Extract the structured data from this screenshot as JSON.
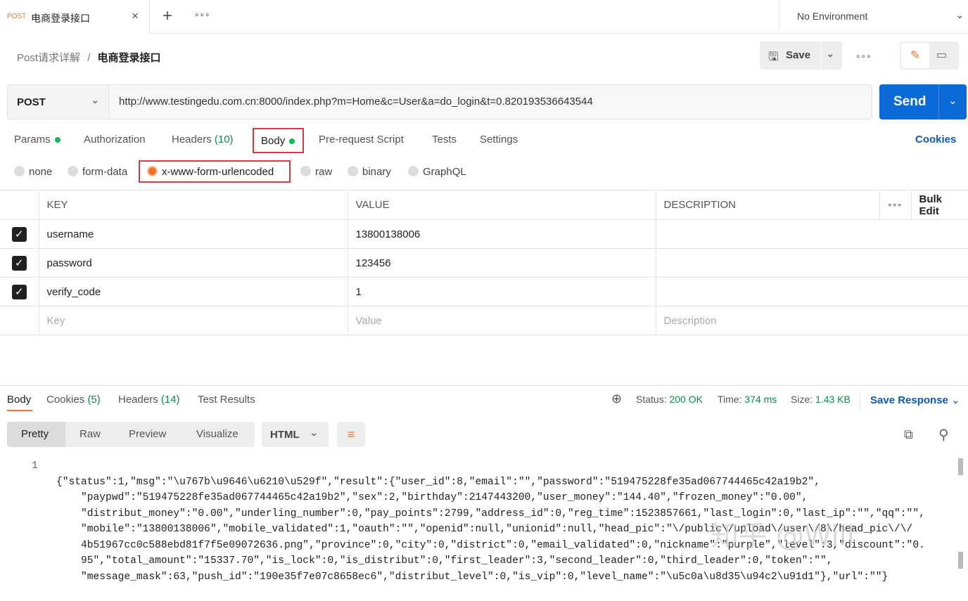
{
  "tabbar": {
    "tab_method": "POST",
    "tab_title": "电商登录接口",
    "close": "×",
    "new_tab": "+",
    "more": "∘∘∘",
    "environment": "No Environment"
  },
  "breadcrumb": {
    "parent": "Post请求详解",
    "sep": "/",
    "current": "电商登录接口"
  },
  "actions": {
    "save": "Save",
    "more": "∘∘∘"
  },
  "request": {
    "method": "POST",
    "url": "http://www.testingedu.com.cn:8000/index.php?m=Home&c=User&a=do_login&t=0.820193536643544",
    "send": "Send"
  },
  "req_tabs": {
    "params": "Params",
    "authorization": "Authorization",
    "headers": "Headers",
    "headers_count": "(10)",
    "body": "Body",
    "prerequest": "Pre-request Script",
    "tests": "Tests",
    "settings": "Settings",
    "cookies": "Cookies"
  },
  "body_types": [
    "none",
    "form-data",
    "x-www-form-urlencoded",
    "raw",
    "binary",
    "GraphQL"
  ],
  "table": {
    "headers": [
      "KEY",
      "VALUE",
      "DESCRIPTION"
    ],
    "more": "∘∘∘",
    "bulk_edit": "Bulk Edit",
    "rows": [
      {
        "key": "username",
        "value": "13800138006"
      },
      {
        "key": "password",
        "value": "123456"
      },
      {
        "key": "verify_code",
        "value": "1"
      }
    ],
    "placeholder": {
      "key": "Key",
      "value": "Value",
      "description": "Description"
    }
  },
  "response": {
    "tabs": {
      "body": "Body",
      "cookies": "Cookies",
      "cookies_count": "(5)",
      "headers": "Headers",
      "headers_count": "(14)",
      "test_results": "Test Results"
    },
    "status_label": "Status:",
    "status": "200 OK",
    "time_label": "Time:",
    "time": "374 ms",
    "size_label": "Size:",
    "size": "1.43 KB",
    "save_response": "Save Response",
    "views": [
      "Pretty",
      "Raw",
      "Preview",
      "Visualize"
    ],
    "format": "HTML",
    "line_number": "1",
    "lines": [
      "{\"status\":1,\"msg\":\"\\u767b\\u9646\\u6210\\u529f\",\"result\":{\"user_id\":8,\"email\":\"\",\"password\":\"519475228fe35ad067744465c42a19b2\",",
      "    \"paypwd\":\"519475228fe35ad067744465c42a19b2\",\"sex\":2,\"birthday\":2147443200,\"user_money\":\"144.40\",\"frozen_money\":\"0.00\",",
      "    \"distribut_money\":\"0.00\",\"underling_number\":0,\"pay_points\":2799,\"address_id\":0,\"reg_time\":1523857661,\"last_login\":0,\"last_ip\":\"\",\"qq\":\"\",",
      "    \"mobile\":\"13800138006\",\"mobile_validated\":1,\"oauth\":\"\",\"openid\":null,\"unionid\":null,\"head_pic\":\"\\/public\\/upload\\/user\\/8\\/head_pic\\/\\/",
      "    4b51967cc0c588ebd81f7f5e09072636.png\",\"province\":0,\"city\":0,\"district\":0,\"email_validated\":0,\"nickname\":\"purple\",\"level\":3,\"discount\":\"0.",
      "    95\",\"total_amount\":\"15337.70\",\"is_lock\":0,\"is_distribut\":0,\"first_leader\":3,\"second_leader\":0,\"third_leader\":0,\"token\":\"\",",
      "    \"message_mask\":63,\"push_id\":\"190e35f7e07c8658ec6\",\"distribut_level\":0,\"is_vip\":0,\"level_name\":\"\\u5c0a\\u8d35\\u94c2\\u91d1\"},\"url\":\"\"}"
    ]
  },
  "watermark": "知乎 @Will"
}
